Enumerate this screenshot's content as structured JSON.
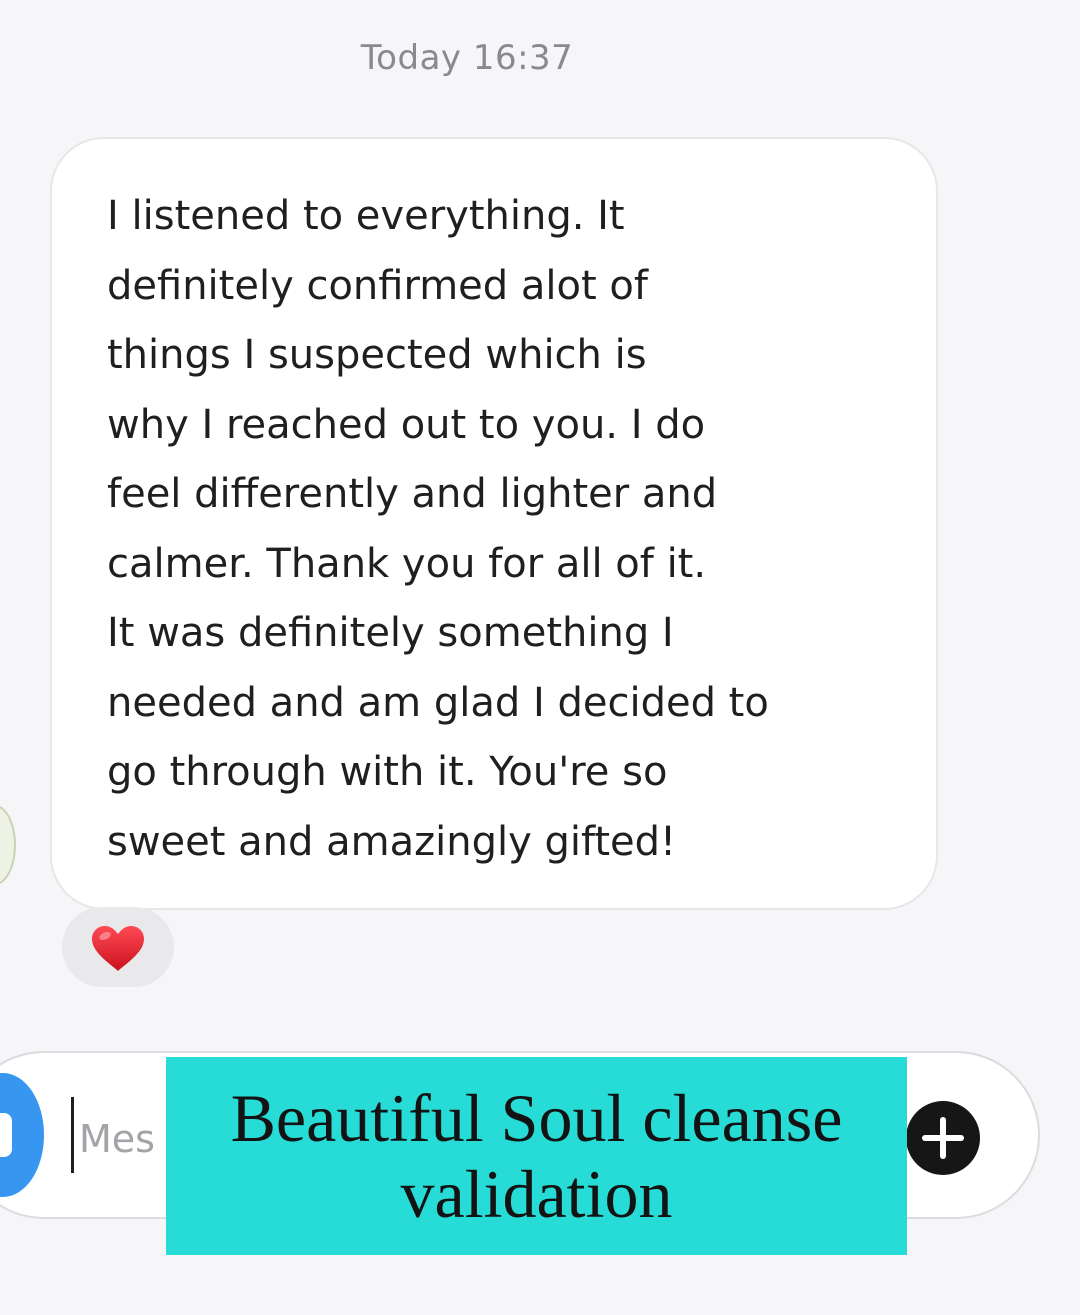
{
  "header": {
    "timestamp": "Today 16:37"
  },
  "message": {
    "text": "I listened to everything. It\ndefinitely confirmed alot of\nthings I suspected which is\nwhy I reached out to you. I do\nfeel differently and lighter and\ncalmer. Thank you for all of it.\nIt was definitely something I\nneeded and am glad I decided to\ngo through with it. You're so\nsweet and amazingly gifted!",
    "reaction": {
      "emoji": "heart",
      "color": "#e3202e"
    }
  },
  "composer": {
    "placeholder": "Mes",
    "camera_icon": "camera-icon",
    "plus_icon": "plus-icon",
    "accent_color": "#3797f0"
  },
  "caption": {
    "line1": "Beautiful Soul cleanse",
    "line2": "validation",
    "background_color": "#27dbd6"
  }
}
